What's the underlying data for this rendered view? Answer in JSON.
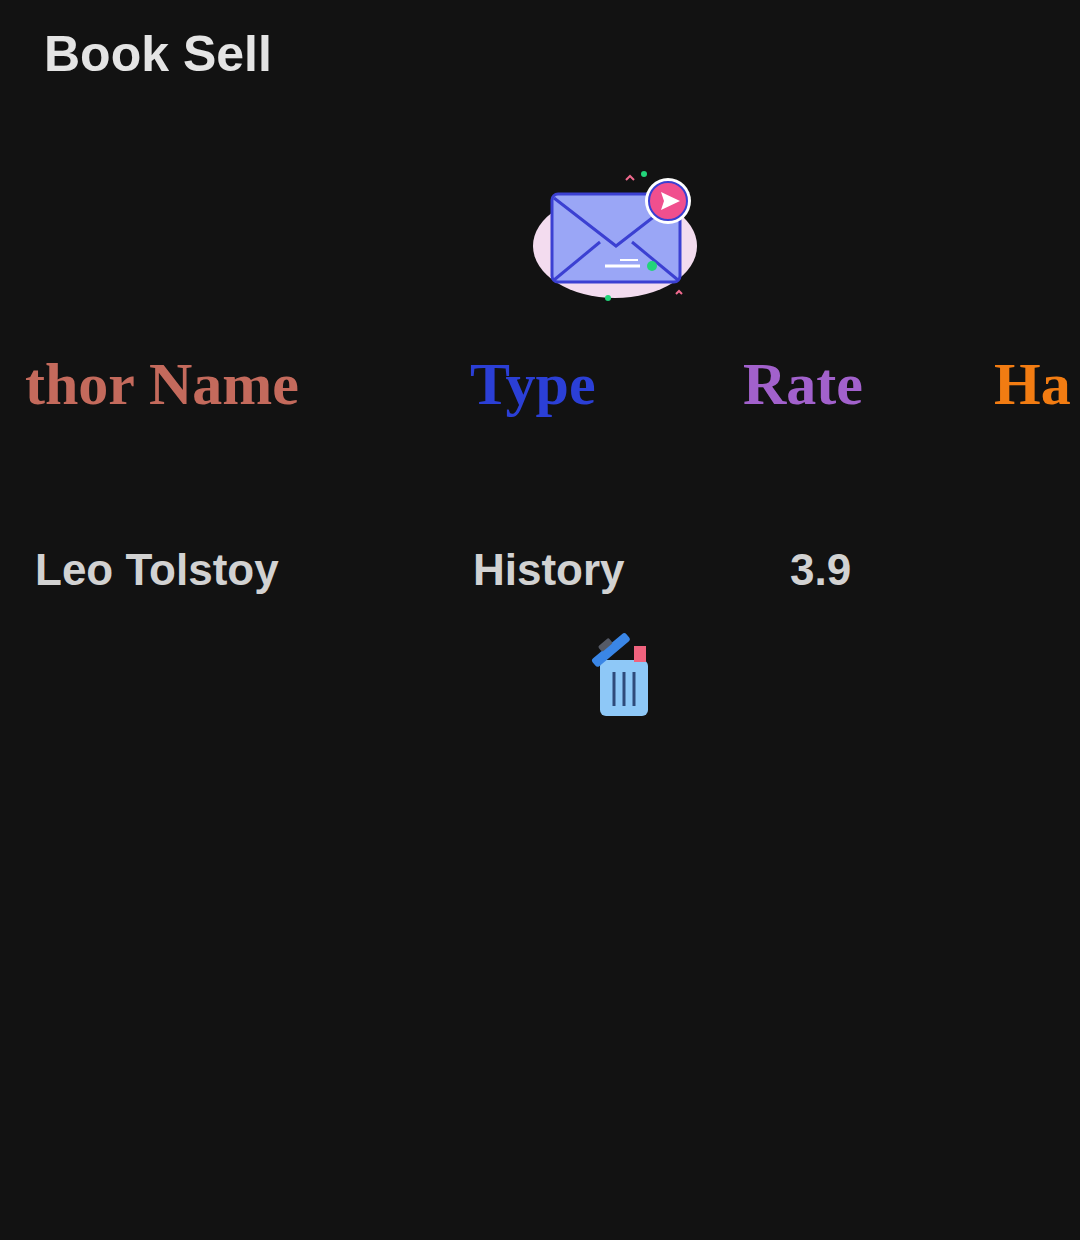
{
  "app": {
    "title": "Book Sell"
  },
  "table": {
    "columns": [
      {
        "label": "thor Name",
        "color": "#c46a5c"
      },
      {
        "label": "Type",
        "color": "#2b3fd6"
      },
      {
        "label": "Rate",
        "color": "#a261cc"
      },
      {
        "label": "Ha",
        "color": "#f27c12"
      }
    ],
    "rows": [
      {
        "cells": [
          "Leo Tolstoy",
          "History",
          "3.9"
        ]
      }
    ]
  }
}
